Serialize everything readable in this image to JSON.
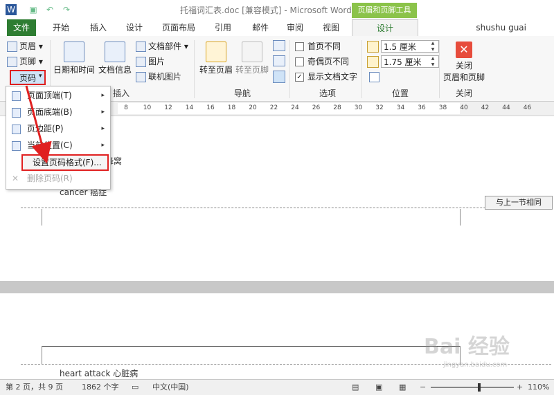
{
  "window": {
    "title": "托福词汇表.doc [兼容模式] - Microsoft Word",
    "context_tab_title": "页眉和页脚工具"
  },
  "tabs": [
    "文件",
    "开始",
    "插入",
    "设计",
    "页面布局",
    "引用",
    "邮件",
    "审阅",
    "视图",
    "设计"
  ],
  "user": "shushu guai",
  "ribbon": {
    "header_footer": {
      "header": "页眉",
      "footer": "页脚",
      "page_number": "页码"
    },
    "insert": {
      "datetime": "日期和时间",
      "docinfo": "文档信息",
      "quickparts": "文档部件",
      "picture": "图片",
      "online_picture": "联机图片",
      "label": "插入"
    },
    "navigation": {
      "goto_header": "转至页眉",
      "goto_footer": "转至页脚",
      "label": "导航"
    },
    "options": {
      "first_page_diff": "首页不同",
      "odd_even_diff": "奇偶页不同",
      "show_doc_text": "显示文档文字",
      "label": "选项"
    },
    "position": {
      "header_pos": "1.5 厘米",
      "footer_pos": "1.75 厘米",
      "label": "位置"
    },
    "close": {
      "button": "关闭\n页眉和页脚",
      "line1": "关闭",
      "line2": "页眉和页脚",
      "label": "关闭"
    }
  },
  "ruler_ticks": [
    "8",
    "10",
    "12",
    "14",
    "16",
    "18",
    "20",
    "22",
    "24",
    "26",
    "28",
    "30",
    "32",
    "34",
    "36",
    "38",
    "40",
    "42",
    "44",
    "46"
  ],
  "menu": {
    "items": [
      {
        "label": "页面顶端(T)",
        "has_sub": true,
        "disabled": false
      },
      {
        "label": "页面底端(B)",
        "has_sub": true,
        "disabled": false
      },
      {
        "label": "页边距(P)",
        "has_sub": true,
        "disabled": false
      },
      {
        "label": "当前位置(C)",
        "has_sub": true,
        "disabled": false
      },
      {
        "label": "设置页码格式(F)...",
        "has_sub": false,
        "disabled": false
      },
      {
        "label": "删除页码(R)",
        "has_sub": false,
        "disabled": true
      }
    ],
    "submenu_arrow": "▸"
  },
  "document": {
    "word1_tail": "蜂窝",
    "word2": "cancer  癌症",
    "same_as_previous": "与上一节相同",
    "word3": "heart attack  心脏病"
  },
  "status": {
    "page": "第 2 页，共 9 页",
    "words": "1862 个字",
    "lang": "中文(中国)",
    "zoom": "110%"
  },
  "watermark": {
    "main": "Bai 经验",
    "sub": "jingyan.baidu.com"
  },
  "colors": {
    "accent": "#2e7d32",
    "highlight": "#e02020",
    "context": "#8bc34a"
  }
}
